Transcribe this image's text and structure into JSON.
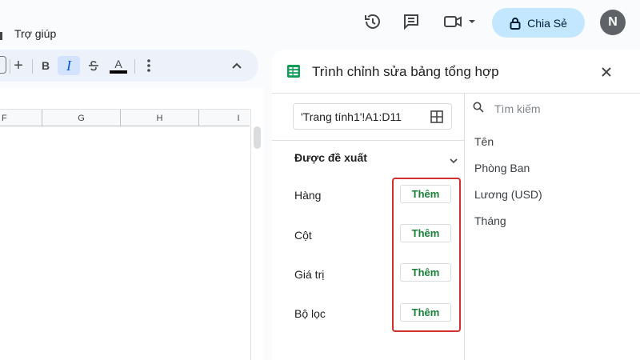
{
  "menu": {
    "help_label": "Trợ giúp"
  },
  "header": {
    "share_label": "Chia Sẻ",
    "avatar_letter": "N"
  },
  "toolbar": {
    "plus": "+",
    "bold": "B",
    "italic": "I",
    "text_color": "A"
  },
  "grid": {
    "columns": [
      "F",
      "G",
      "H",
      "I"
    ]
  },
  "pivot_panel": {
    "title": "Trình chỉnh sửa bảng tổng hợp",
    "range": "'Trang tính1'!A1:D11",
    "suggested_label": "Được đề xuất",
    "sections": [
      {
        "label": "Hàng",
        "add_label": "Thêm"
      },
      {
        "label": "Cột",
        "add_label": "Thêm"
      },
      {
        "label": "Giá trị",
        "add_label": "Thêm"
      },
      {
        "label": "Bộ lọc",
        "add_label": "Thêm"
      }
    ],
    "search_placeholder": "Tìm kiếm",
    "fields": [
      "Tên",
      "Phòng Ban",
      "Lương (USD)",
      "Tháng"
    ]
  },
  "colors": {
    "accent_share": "#c2e7ff",
    "add_text": "#188038",
    "highlight": "#d32f2f",
    "sheets_green": "#0f9d58"
  }
}
